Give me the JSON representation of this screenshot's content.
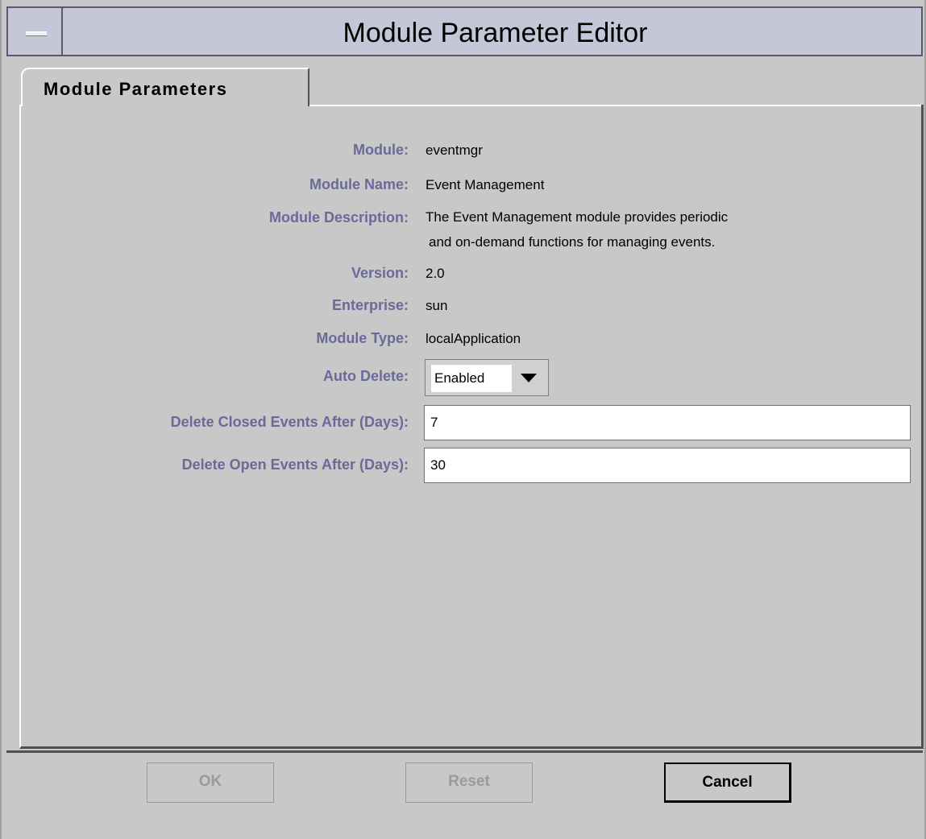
{
  "window": {
    "title": "Module Parameter Editor"
  },
  "tabs": [
    {
      "label": "Module Parameters"
    }
  ],
  "fields": {
    "module": {
      "label": "Module:",
      "value": "eventmgr"
    },
    "module_name": {
      "label": "Module Name:",
      "value": "Event Management"
    },
    "module_description": {
      "label": "Module Description:",
      "lines": [
        "The Event Management module provides periodic",
        "and on-demand functions for managing events."
      ]
    },
    "version": {
      "label": "Version:",
      "value": "2.0"
    },
    "enterprise": {
      "label": "Enterprise:",
      "value": "sun"
    },
    "module_type": {
      "label": "Module Type:",
      "value": "localApplication"
    },
    "auto_delete": {
      "label": "Auto Delete:",
      "value": "Enabled"
    },
    "delete_closed": {
      "label": "Delete Closed Events After (Days):",
      "value": "7"
    },
    "delete_open": {
      "label": "Delete Open Events After (Days):",
      "value": "30"
    }
  },
  "buttons": {
    "ok": "OK",
    "reset": "Reset",
    "cancel": "Cancel"
  },
  "colors": {
    "label": "#6a6a9a",
    "titlebar": "#c3c7d8",
    "background": "#c8c8c8"
  },
  "icons": {
    "window_menu": "window-menu-icon",
    "dropdown": "chevron-down-icon"
  }
}
